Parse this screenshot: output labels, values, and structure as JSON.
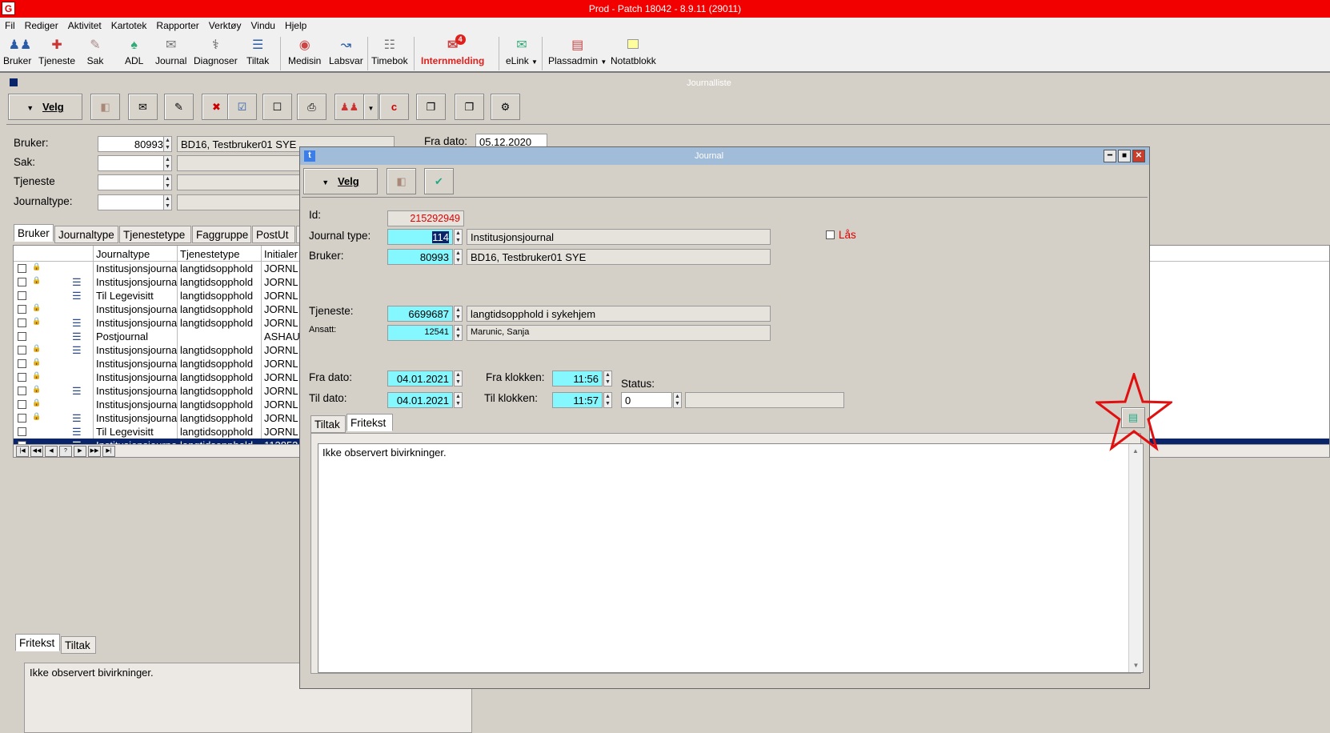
{
  "app": {
    "title": "Prod - Patch 18042 - 8.9.11 (29011)",
    "logo": "G"
  },
  "menu": [
    "Fil",
    "Rediger",
    "Aktivitet",
    "Kartotek",
    "Rapporter",
    "Verktøy",
    "Vindu",
    "Hjelp"
  ],
  "toolbar": [
    {
      "label": "Bruker",
      "icon": "users-icon"
    },
    {
      "label": "Tjeneste",
      "icon": "service-icon"
    },
    {
      "label": "Sak",
      "icon": "case-icon"
    },
    {
      "label": "ADL",
      "icon": "adl-icon"
    },
    {
      "label": "Journal",
      "icon": "journal-icon"
    },
    {
      "label": "Diagnoser",
      "icon": "stethoscope-icon"
    },
    {
      "label": "Tiltak",
      "icon": "list-icon"
    },
    {
      "label": "Medisin",
      "icon": "medicine-icon"
    },
    {
      "label": "Labsvar",
      "icon": "chart-icon"
    },
    {
      "label": "Timebok",
      "icon": "calendar-icon"
    },
    {
      "label": "Internmelding",
      "icon": "message-icon",
      "badge": "4"
    },
    {
      "label": "eLink",
      "icon": "envelope-icon"
    },
    {
      "label": "Plassadmin",
      "icon": "bed-icon"
    },
    {
      "label": "Notatblokk",
      "icon": "note-icon"
    }
  ],
  "journalliste": {
    "title": "Journalliste",
    "velg": "Velg",
    "labels": {
      "bruker": "Bruker:",
      "sak": "Sak:",
      "tjeneste": "Tjeneste",
      "journaltype": "Journaltype:",
      "fra_dato": "Fra dato:"
    },
    "bruker_id": "80993",
    "bruker_name": "BD16, Testbruker01 SYE",
    "fra_dato": "05.12.2020",
    "tabs": [
      "Bruker",
      "Journaltype",
      "Tjenestetype",
      "Faggruppe",
      "PostUt",
      "A"
    ],
    "columns": [
      "Journaltype",
      "Tjenestetype",
      "Initialer"
    ],
    "rows": [
      {
        "lock": true,
        "doc": false,
        "type": "Institusjonsjournal",
        "tj": "langtidsopphold",
        "ini": "JORNL"
      },
      {
        "lock": true,
        "doc": true,
        "type": "Institusjonsjournal",
        "tj": "langtidsopphold",
        "ini": "JORNL"
      },
      {
        "lock": false,
        "doc": true,
        "type": "Til Legevisitt",
        "tj": "langtidsopphold",
        "ini": "JORNL"
      },
      {
        "lock": true,
        "doc": false,
        "type": "Institusjonsjournal",
        "tj": "langtidsopphold",
        "ini": "JORNL"
      },
      {
        "lock": true,
        "doc": true,
        "type": "Institusjonsjournal",
        "tj": "langtidsopphold",
        "ini": "JORNL"
      },
      {
        "lock": false,
        "doc": true,
        "type": "Postjournal",
        "tj": "",
        "ini": "ASHAU"
      },
      {
        "lock": true,
        "doc": true,
        "type": "Institusjonsjournal",
        "tj": "langtidsopphold",
        "ini": "JORNL"
      },
      {
        "lock": true,
        "doc": false,
        "type": "Institusjonsjournal",
        "tj": "langtidsopphold",
        "ini": "JORNL"
      },
      {
        "lock": true,
        "doc": false,
        "type": "Institusjonsjournal",
        "tj": "langtidsopphold",
        "ini": "JORNL"
      },
      {
        "lock": true,
        "doc": true,
        "type": "Institusjonsjournal",
        "tj": "langtidsopphold",
        "ini": "JORNL"
      },
      {
        "lock": true,
        "doc": false,
        "type": "Institusjonsjournal",
        "tj": "langtidsopphold",
        "ini": "JORNL"
      },
      {
        "lock": true,
        "doc": true,
        "type": "Institusjonsjournal",
        "tj": "langtidsopphold",
        "ini": "JORNL"
      },
      {
        "lock": false,
        "doc": true,
        "type": "Til Legevisitt",
        "tj": "langtidsopphold",
        "ini": "JORNL"
      },
      {
        "lock": false,
        "doc": true,
        "type": "Institusjonsjournal",
        "tj": "langtidsopphold",
        "ini": "113853",
        "selected": true
      }
    ],
    "nav": [
      "|◀",
      "◀◀",
      "◀",
      "?",
      "▶",
      "▶▶",
      "▶|"
    ],
    "bottom_tabs": [
      "Fritekst",
      "Tiltak"
    ],
    "bottom_text": "Ikke observert bivirkninger."
  },
  "journal": {
    "title": "Journal",
    "velg": "Velg",
    "labels": {
      "id": "Id:",
      "journal_type": "Journal type:",
      "bruker": "Bruker:",
      "tjeneste": "Tjeneste:",
      "ansatt": "Ansatt:",
      "fra_dato": "Fra dato:",
      "til_dato": "Til dato:",
      "fra_klokken": "Fra klokken:",
      "til_klokken": "Til klokken:",
      "status": "Status:",
      "las": "Lås"
    },
    "id": "215292949",
    "journal_type_id": "114",
    "journal_type_name": "Institusjonsjournal",
    "bruker_id": "80993",
    "bruker_name": "BD16, Testbruker01 SYE",
    "tjeneste_id": "6699687",
    "tjeneste_name": "langtidsopphold i sykehjem",
    "ansatt_id": "12541",
    "ansatt_name": "Marunic, Sanja",
    "fra_dato": "04.01.2021",
    "til_dato": "04.01.2021",
    "fra_klokken": "11:56",
    "til_klokken": "11:57",
    "status": "0",
    "tabs": [
      "Tiltak",
      "Fritekst"
    ],
    "fritekst": "Ikke observert bivirkninger."
  }
}
